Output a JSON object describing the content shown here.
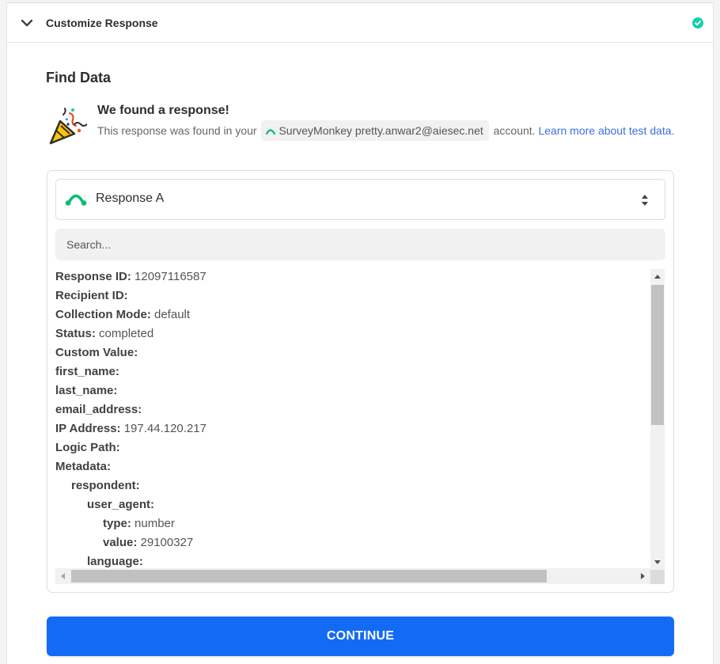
{
  "header": {
    "title": "Customize Response",
    "status_color": "#13d0ab"
  },
  "section": {
    "title": "Find Data"
  },
  "result": {
    "heading": "We found a response!",
    "text_before": "This response was found in your",
    "account_pill": "SurveyMonkey pretty.anwar2@aiesec.net",
    "text_after": "account.",
    "link_text": "Learn more about test data."
  },
  "selector": {
    "label": "Response A",
    "logo_color": "#00bf6f"
  },
  "search": {
    "placeholder": "Search..."
  },
  "fields": [
    {
      "key": "Response ID:",
      "value": "12097116587",
      "indent": 0
    },
    {
      "key": "Recipient ID:",
      "value": "",
      "indent": 0
    },
    {
      "key": "Collection Mode:",
      "value": "default",
      "indent": 0
    },
    {
      "key": "Status:",
      "value": "completed",
      "indent": 0
    },
    {
      "key": "Custom Value:",
      "value": "",
      "indent": 0
    },
    {
      "key": "first_name:",
      "value": "",
      "indent": 0
    },
    {
      "key": "last_name:",
      "value": "",
      "indent": 0
    },
    {
      "key": "email_address:",
      "value": "",
      "indent": 0
    },
    {
      "key": "IP Address:",
      "value": "197.44.120.217",
      "indent": 0
    },
    {
      "key": "Logic Path:",
      "value": "",
      "indent": 0
    },
    {
      "key": "Metadata:",
      "value": "",
      "indent": 0
    },
    {
      "key": "respondent:",
      "value": "",
      "indent": 1
    },
    {
      "key": "user_agent:",
      "value": "",
      "indent": 2
    },
    {
      "key": "type:",
      "value": "number",
      "indent": 3
    },
    {
      "key": "value:",
      "value": "29100327",
      "indent": 3
    },
    {
      "key": "language:",
      "value": "",
      "indent": 2
    }
  ],
  "scroll": {
    "vertical_position": 0.0,
    "horizontal_position": 0.0
  },
  "continue_button": {
    "label": "CONTINUE",
    "color": "#136bf5"
  }
}
